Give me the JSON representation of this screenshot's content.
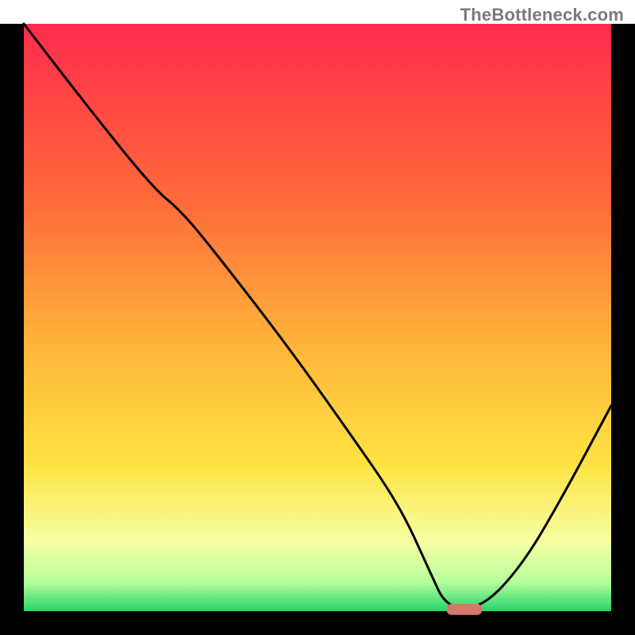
{
  "watermark": "TheBottleneck.com",
  "chart_data": {
    "type": "line",
    "title": "",
    "xlabel": "",
    "ylabel": "",
    "xlim": [
      0,
      100
    ],
    "ylim": [
      0,
      100
    ],
    "grid": false,
    "curve": {
      "name": "bottleneck-curve",
      "x": [
        0,
        10,
        22,
        27,
        35,
        45,
        55,
        64,
        69,
        72,
        78,
        85,
        92,
        100
      ],
      "y": [
        100,
        87,
        72,
        68,
        58,
        45,
        31,
        18,
        7,
        0.5,
        0.5,
        8,
        20,
        35
      ],
      "note": "y estimated as percent height of plot area; 0 = bottom, 100 = top"
    },
    "marker": {
      "name": "optimal-range",
      "x_start": 72,
      "x_end": 78,
      "y": 0.3,
      "color": "#d6786b"
    },
    "background_gradient": {
      "stops": [
        {
          "pos": 0.0,
          "color": "#ff2b4d"
        },
        {
          "pos": 0.3,
          "color": "#ff6a3a"
        },
        {
          "pos": 0.55,
          "color": "#ffb53a"
        },
        {
          "pos": 0.75,
          "color": "#ffe342"
        },
        {
          "pos": 0.88,
          "color": "#f7ffa2"
        },
        {
          "pos": 0.95,
          "color": "#b6ff9c"
        },
        {
          "pos": 1.0,
          "color": "#27d36a"
        }
      ]
    },
    "frame_color": "#000000"
  }
}
